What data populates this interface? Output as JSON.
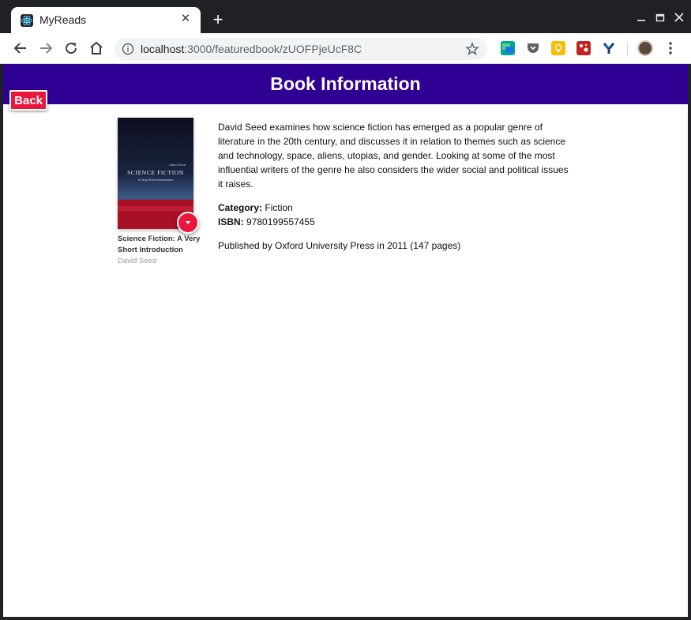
{
  "browser": {
    "tab_title": "MyReads",
    "tab_close": "✕",
    "new_tab": "+",
    "url_host": "localhost",
    "url_path": ":3000/featuredbook/zUOFPjeUcF8C"
  },
  "page": {
    "header_title": "Book Information",
    "back_label": "Back"
  },
  "book": {
    "title": "Science Fiction: A Very Short Introduction",
    "author": "David Seed",
    "cover_author": "David Seed",
    "cover_title": "SCIENCE FICTION",
    "cover_subtitle": "A Very Short Introduction",
    "description": "David Seed examines how science fiction has emerged as a popular genre of literature in the 20th century, and discusses it in relation to themes such as science and technology, space, aliens, utopias, and gender. Looking at some of the most influential writers of the genre he also considers the wider social and political issues it raises.",
    "category_label": "Category:",
    "category": "Fiction",
    "isbn_label": "ISBN:",
    "isbn": "9780199557455",
    "published": "Published by Oxford University Press in 2011 (147 pages)"
  },
  "colors": {
    "header_bg": "#2e0094",
    "accent_red": "#e8173b"
  }
}
